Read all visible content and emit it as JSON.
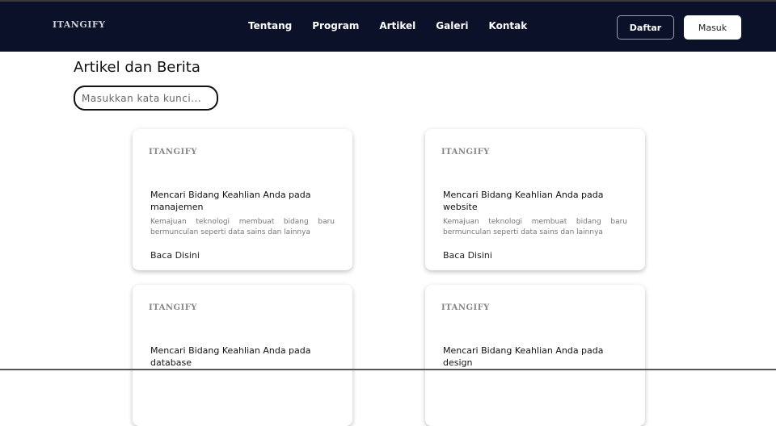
{
  "nav": {
    "logo": "ITANGIFY",
    "menu": [
      "Tentang",
      "Program",
      "Artikel",
      "Galeri",
      "Kontak"
    ],
    "register": "Daftar",
    "login": "Masuk"
  },
  "main": {
    "title": "Artikel dan Berita",
    "search_placeholder": "Masukkan kata kunci..."
  },
  "articles": [
    {
      "logo": "ITANGIFY",
      "title": "Mencari Bidang Keahlian Anda pada manajemen",
      "desc": "Kemajuan teknologi membuat bidang baru bermunculan seperti data sains dan lainnya",
      "link": "Baca Disini"
    },
    {
      "logo": "ITANGIFY",
      "title": "Mencari Bidang Keahlian Anda pada website",
      "desc": "Kemajuan teknologi membuat bidang baru bermunculan seperti data sains dan lainnya",
      "link": "Baca Disini"
    },
    {
      "logo": "ITANGIFY",
      "title": "Mencari Bidang Keahlian Anda pada database"
    },
    {
      "logo": "ITANGIFY",
      "title": "Mencari Bidang Keahlian Anda pada design"
    }
  ]
}
